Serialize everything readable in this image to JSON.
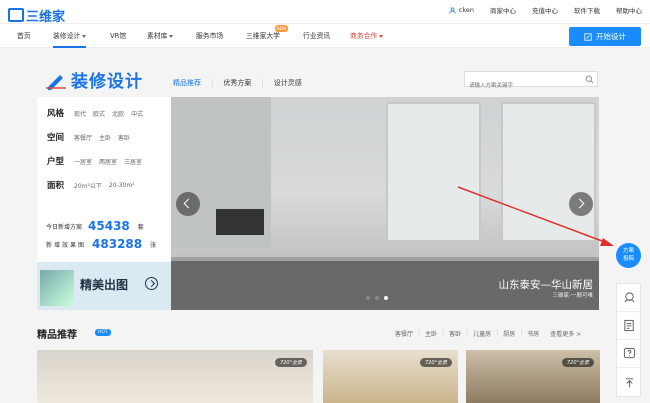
{
  "topbar": {
    "logo_text": "三维家",
    "username": "cken",
    "links": [
      "商家中心",
      "充值中心",
      "软件下载",
      "帮助中心"
    ]
  },
  "nav": {
    "items": [
      {
        "label": "首页"
      },
      {
        "label": "装修设计"
      },
      {
        "label": "VR馆"
      },
      {
        "label": "素材库"
      },
      {
        "label": "服务市场"
      },
      {
        "label": "三维家大学",
        "badge": "NEW"
      },
      {
        "label": "行业资讯"
      },
      {
        "label": "商务合作"
      }
    ],
    "start_button": "开始设计"
  },
  "design": {
    "title": "装修设计",
    "tabs": [
      "精品推荐",
      "优秀方案",
      "设计灵感"
    ],
    "search_placeholder": "请输入方案关键字"
  },
  "filters": [
    {
      "label": "风格",
      "options": [
        "现代",
        "欧式",
        "北欧",
        "中式"
      ]
    },
    {
      "label": "空间",
      "options": [
        "客餐厅",
        "主卧",
        "客卧"
      ]
    },
    {
      "label": "户型",
      "options": [
        "一居室",
        "两居室",
        "三居室"
      ]
    },
    {
      "label": "面积",
      "options": [
        "20m²以下",
        "20-30m²"
      ]
    }
  ],
  "stats": [
    {
      "label": "今日新增方案",
      "value": "45438",
      "unit": "套"
    },
    {
      "label": "新增效果图",
      "value": "483288",
      "unit": "张"
    }
  ],
  "promo": {
    "text": "精美出图"
  },
  "hero": {
    "title": "山东泰安—华山新居",
    "subtitle": "三维家-一颇可唯"
  },
  "side": {
    "fab_label": "方案投稿"
  },
  "recommend": {
    "title": "精品推荐",
    "hot": "HOT",
    "categories": [
      "客餐厅",
      "主卧",
      "客卧",
      "儿童房",
      "厨房",
      "书房"
    ],
    "more": "查看更多 >",
    "badge": "720°全景"
  },
  "colors": {
    "accent": "#1a73e8",
    "button": "#1a8cff",
    "partner": "#e04a3f"
  }
}
